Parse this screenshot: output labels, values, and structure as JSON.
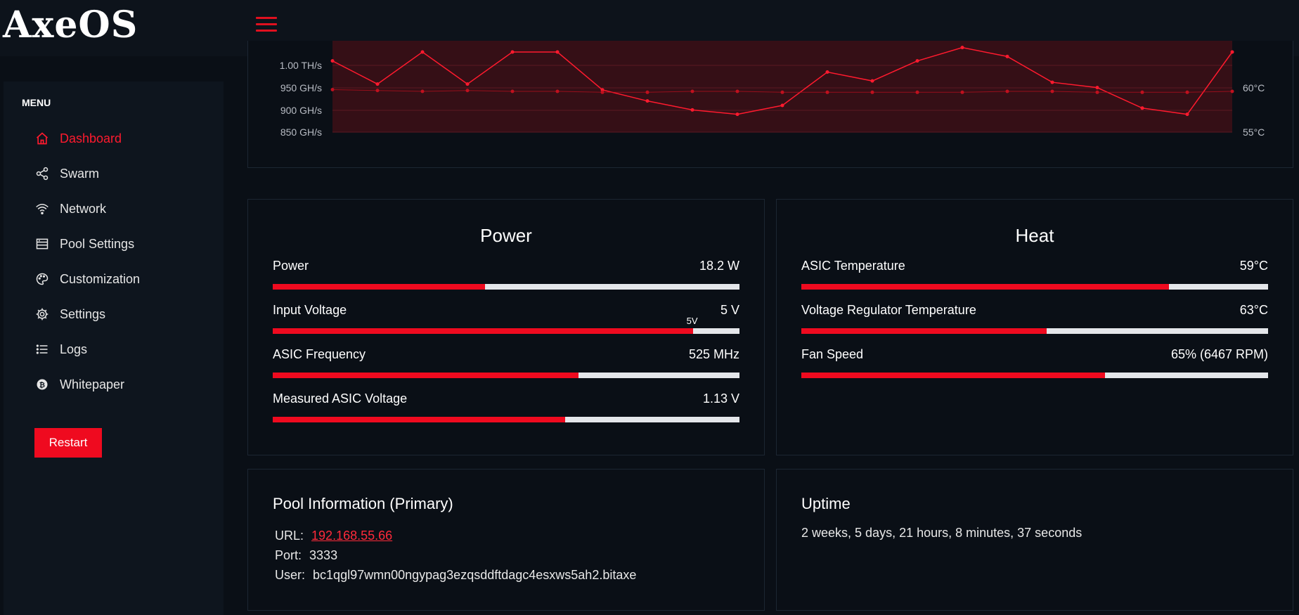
{
  "app": {
    "logo_text": "AxeOS"
  },
  "sidebar": {
    "menu_title": "MENU",
    "items": [
      {
        "label": "Dashboard",
        "icon": "home-icon",
        "active": true
      },
      {
        "label": "Swarm",
        "icon": "share-icon",
        "active": false
      },
      {
        "label": "Network",
        "icon": "wifi-icon",
        "active": false
      },
      {
        "label": "Pool Settings",
        "icon": "server-icon",
        "active": false
      },
      {
        "label": "Customization",
        "icon": "palette-icon",
        "active": false
      },
      {
        "label": "Settings",
        "icon": "gear-icon",
        "active": false
      },
      {
        "label": "Logs",
        "icon": "list-icon",
        "active": false
      },
      {
        "label": "Whitepaper",
        "icon": "bitcoin-icon",
        "active": false
      }
    ],
    "restart_label": "Restart"
  },
  "chart_data": {
    "type": "line",
    "y_left_ticks": [
      "1.00 TH/s",
      "950 GH/s",
      "900 GH/s",
      "850 GH/s"
    ],
    "y_right_ticks": [
      "60°C",
      "55°C"
    ],
    "ylim_hashrate_ghs": [
      850,
      1000
    ],
    "series": [
      {
        "unit": "GH/s",
        "color": "#ff1a2e",
        "values": [
          1010,
          958,
          1030,
          958,
          1030,
          1030,
          945,
          920,
          900,
          890,
          910,
          985,
          965,
          1010,
          1040,
          1020,
          962,
          950,
          904,
          890,
          1030
        ]
      },
      {
        "unit": "°C",
        "color": "#c0101e",
        "values": [
          59.8,
          59.7,
          59.6,
          59.7,
          59.6,
          59.6,
          59.5,
          59.5,
          59.6,
          59.6,
          59.5,
          59.5,
          59.5,
          59.5,
          59.5,
          59.6,
          59.6,
          59.5,
          59.5,
          59.5,
          59.6
        ]
      }
    ]
  },
  "power": {
    "title": "Power",
    "metrics": [
      {
        "label": "Power",
        "value": "18.2 W",
        "fill": 0.455
      },
      {
        "label": "Input Voltage",
        "value": "5 V",
        "fill": 0.9,
        "marker": "5V"
      },
      {
        "label": "ASIC Frequency",
        "value": "525 MHz",
        "fill": 0.655
      },
      {
        "label": "Measured ASIC Voltage",
        "value": "1.13 V",
        "fill": 0.627
      }
    ]
  },
  "heat": {
    "title": "Heat",
    "metrics": [
      {
        "label": "ASIC Temperature",
        "value": "59°C",
        "fill": 0.787
      },
      {
        "label": "Voltage Regulator Temperature",
        "value": "63°C",
        "fill": 0.525
      },
      {
        "label": "Fan Speed",
        "value": "65% (6467 RPM)",
        "fill": 0.65
      }
    ]
  },
  "pool": {
    "title": "Pool Information (Primary)",
    "url_key": "URL:",
    "url_value": "192.168.55.66",
    "port_key": "Port:",
    "port_value": "3333",
    "user_key": "User:",
    "user_value": "bc1qgl97wmn00ngypag3ezqsddftdagc4esxws5ah2.bitaxe"
  },
  "uptime": {
    "title": "Uptime",
    "value": "2 weeks, 5 days, 21 hours, 8 minutes, 37 seconds"
  },
  "colors": {
    "accent": "#ef0a1f",
    "background": "#0a0f16",
    "panel": "#0e151e"
  }
}
